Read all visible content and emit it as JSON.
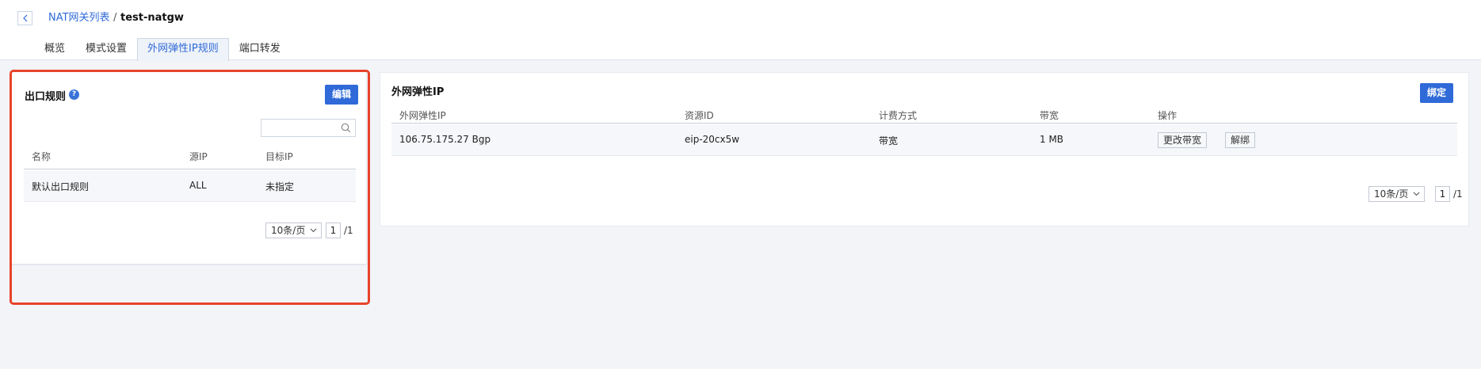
{
  "breadcrumb": {
    "parent": "NAT网关列表",
    "separator": "/",
    "current": "test-natgw"
  },
  "tabs": [
    {
      "label": "概览"
    },
    {
      "label": "模式设置"
    },
    {
      "label": "外网弹性IP规则"
    },
    {
      "label": "端口转发"
    }
  ],
  "active_tab": "外网弹性IP规则",
  "egress": {
    "title": "出口规则",
    "help_icon": "?",
    "edit_label": "编辑",
    "search_placeholder": "",
    "columns": [
      "名称",
      "源IP",
      "目标IP"
    ],
    "rows": [
      {
        "name": "默认出口规则",
        "source_ip": "ALL",
        "target_ip": "未指定"
      }
    ],
    "pager": {
      "page_size": "10条/页",
      "page": "1",
      "total": "/1"
    }
  },
  "eip": {
    "title": "外网弹性IP",
    "bind_label": "绑定",
    "columns": [
      "外网弹性IP",
      "资源ID",
      "计费方式",
      "带宽",
      "操作"
    ],
    "rows": [
      {
        "ip": "106.75.175.27 Bgp",
        "resource_id": "eip-20cx5w",
        "billing": "带宽",
        "bandwidth": "1 MB",
        "action_change": "更改带宽",
        "action_unbind": "解绑"
      }
    ],
    "pager": {
      "page_size": "10条/页",
      "page": "1",
      "total": "/1"
    }
  },
  "colors": {
    "accent": "#2f6ad8",
    "highlight": "#e8432a",
    "background": "#f2f4f8"
  },
  "icons": {
    "back": "chevron-left-icon",
    "search": "search-icon",
    "help": "help-icon",
    "dropdown": "chevron-down-icon"
  }
}
